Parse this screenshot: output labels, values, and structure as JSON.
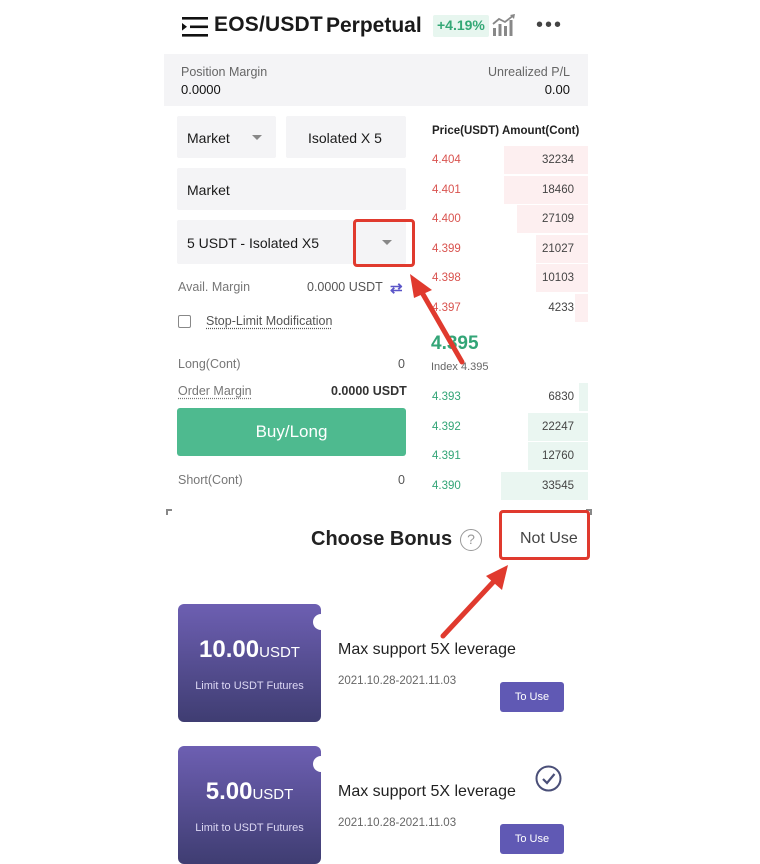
{
  "header": {
    "pair": "EOS/USDT",
    "contract": "Perpetual",
    "change": "+4.19%",
    "icons": [
      "menu-icon",
      "chart-icon",
      "more-icon"
    ]
  },
  "position": {
    "margin_label": "Position Margin",
    "margin_value": "0.0000",
    "pnl_label": "Unrealized P/L",
    "pnl_value": "0.00"
  },
  "form": {
    "order_type": "Market",
    "leverage": "Isolated X 5",
    "price_input": "Market",
    "bonus_select": "5 USDT - Isolated X5",
    "avail_label": "Avail. Margin",
    "avail_value": "0.0000 USDT",
    "stop_limit": "Stop-Limit Modification",
    "long_label": "Long(Cont)",
    "long_value": "0",
    "order_margin_label": "Order Margin",
    "order_margin_value": "0.0000 USDT",
    "buy_label": "Buy/Long",
    "short_label": "Short(Cont)",
    "short_value": "0"
  },
  "orderbook": {
    "price_header": "Price(USDT)",
    "amount_header": "Amount(Cont)",
    "asks": [
      {
        "price": "4.404",
        "amount": "32234",
        "depth": 0.53
      },
      {
        "price": "4.401",
        "amount": "18460",
        "depth": 0.53
      },
      {
        "price": "4.400",
        "amount": "27109",
        "depth": 0.45
      },
      {
        "price": "4.399",
        "amount": "21027",
        "depth": 0.33
      },
      {
        "price": "4.398",
        "amount": "10103",
        "depth": 0.33
      },
      {
        "price": "4.397",
        "amount": "4233",
        "depth": 0.08
      }
    ],
    "last_price": "4.395",
    "index": "Index 4.395",
    "bids": [
      {
        "price": "4.393",
        "amount": "6830",
        "depth": 0.06
      },
      {
        "price": "4.392",
        "amount": "22247",
        "depth": 0.38
      },
      {
        "price": "4.391",
        "amount": "12760",
        "depth": 0.38
      },
      {
        "price": "4.390",
        "amount": "33545",
        "depth": 0.55
      }
    ]
  },
  "bonus": {
    "title": "Choose Bonus",
    "help": "?",
    "not_use": "Not Use",
    "coupons": [
      {
        "amount": "10.00",
        "unit": "USDT",
        "limit": "Limit to USDT Futures",
        "title": "Max support 5X leverage",
        "dates": "2021.10.28-2021.11.03",
        "button": "To Use",
        "selected": false
      },
      {
        "amount": "5.00",
        "unit": "USDT",
        "limit": "Limit to USDT Futures",
        "title": "Max support 5X leverage",
        "dates": "2021.10.28-2021.11.03",
        "button": "To Use",
        "selected": true
      }
    ]
  },
  "colors": {
    "accent_green": "#4eba8f",
    "ask_red": "#d9534f",
    "bonus_purple": "#6059b4",
    "highlight_red": "#e03a2e"
  }
}
